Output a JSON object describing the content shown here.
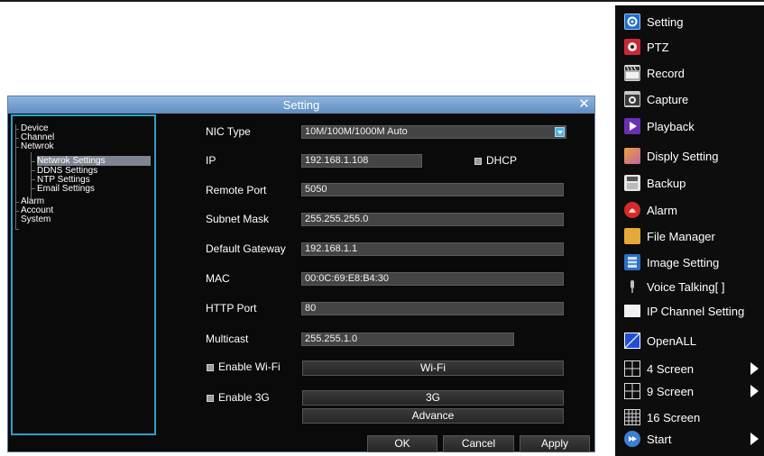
{
  "dialog": {
    "title": "Setting",
    "close_glyph": "✕",
    "tree": {
      "items": [
        {
          "label": "Device"
        },
        {
          "label": "Channel"
        },
        {
          "label": "Netwrok"
        },
        {
          "label": "Netwrok Settings",
          "selected": true
        },
        {
          "label": "DDNS Settings"
        },
        {
          "label": "NTP Settings"
        },
        {
          "label": "Email Settings"
        },
        {
          "label": "Alarm"
        },
        {
          "label": "Account"
        },
        {
          "label": "System"
        }
      ]
    },
    "form": {
      "nic_type": {
        "label": "NIC Type",
        "value": "10M/100M/1000M Auto"
      },
      "ip": {
        "label": "IP",
        "value": "192.168.1.108"
      },
      "dhcp": {
        "label": "DHCP"
      },
      "remote_port": {
        "label": "Remote Port",
        "value": "5050"
      },
      "subnet_mask": {
        "label": "Subnet Mask",
        "value": "255.255.255.0"
      },
      "default_gateway": {
        "label": "Default Gateway",
        "value": "192.168.1.1"
      },
      "mac": {
        "label": "MAC",
        "value": "00:0C:69:E8:B4:30"
      },
      "http_port": {
        "label": "HTTP Port",
        "value": "80"
      },
      "multicast": {
        "label": "Multicast",
        "value": "255.255.1.0"
      },
      "enable_wifi": {
        "label": "Enable Wi-Fi"
      },
      "wifi_button": "Wi-Fi",
      "enable_3g": {
        "label": "Enable 3G"
      },
      "threeg_button": "3G",
      "advance_button": "Advance"
    },
    "buttons": {
      "ok": "OK",
      "cancel": "Cancel",
      "apply": "Apply"
    }
  },
  "side_menu": {
    "items": [
      {
        "label": "Setting",
        "icon": "setting-icon"
      },
      {
        "label": "PTZ",
        "icon": "ptz-icon"
      },
      {
        "label": "Record",
        "icon": "record-clapper-icon"
      },
      {
        "label": "Capture",
        "icon": "camera-icon"
      },
      {
        "label": "Playback",
        "icon": "play-icon"
      },
      {
        "label": "Disply Setting",
        "icon": "display-icon"
      },
      {
        "label": "Backup",
        "icon": "backup-icon"
      },
      {
        "label": "Alarm",
        "icon": "alarm-icon"
      },
      {
        "label": "File Manager",
        "icon": "folder-icon"
      },
      {
        "label": "Image Setting",
        "icon": "image-setting-icon"
      },
      {
        "label": "Voice Talking[ ]",
        "icon": "microphone-icon"
      },
      {
        "label": "IP Channel Setting",
        "icon": "ip-channel-icon"
      },
      {
        "label": "OpenALL",
        "icon": "open-all-icon"
      },
      {
        "label": "4 Screen",
        "icon": "four-screen-icon",
        "submenu": true
      },
      {
        "label": "9 Screen",
        "icon": "nine-screen-icon",
        "submenu": true
      },
      {
        "label": "16 Screen",
        "icon": "sixteen-screen-icon"
      },
      {
        "label": "Start",
        "icon": "start-icon",
        "submenu": true
      }
    ]
  },
  "colors": {
    "titlebar": "#6f9cd0",
    "tree_border": "#2f9fc8",
    "selection": "#7d8590",
    "field_bg": "#444444",
    "menu_bg": "#0d0d0d"
  }
}
